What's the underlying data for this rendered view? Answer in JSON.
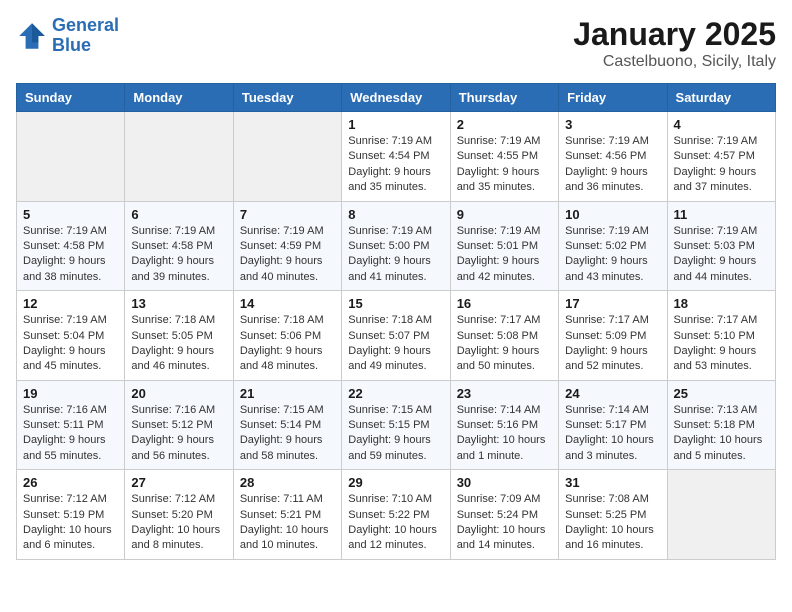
{
  "logo": {
    "line1": "General",
    "line2": "Blue"
  },
  "title": "January 2025",
  "subtitle": "Castelbuono, Sicily, Italy",
  "days_of_week": [
    "Sunday",
    "Monday",
    "Tuesday",
    "Wednesday",
    "Thursday",
    "Friday",
    "Saturday"
  ],
  "weeks": [
    [
      {
        "day": "",
        "info": ""
      },
      {
        "day": "",
        "info": ""
      },
      {
        "day": "",
        "info": ""
      },
      {
        "day": "1",
        "info": "Sunrise: 7:19 AM\nSunset: 4:54 PM\nDaylight: 9 hours and 35 minutes."
      },
      {
        "day": "2",
        "info": "Sunrise: 7:19 AM\nSunset: 4:55 PM\nDaylight: 9 hours and 35 minutes."
      },
      {
        "day": "3",
        "info": "Sunrise: 7:19 AM\nSunset: 4:56 PM\nDaylight: 9 hours and 36 minutes."
      },
      {
        "day": "4",
        "info": "Sunrise: 7:19 AM\nSunset: 4:57 PM\nDaylight: 9 hours and 37 minutes."
      }
    ],
    [
      {
        "day": "5",
        "info": "Sunrise: 7:19 AM\nSunset: 4:58 PM\nDaylight: 9 hours and 38 minutes."
      },
      {
        "day": "6",
        "info": "Sunrise: 7:19 AM\nSunset: 4:58 PM\nDaylight: 9 hours and 39 minutes."
      },
      {
        "day": "7",
        "info": "Sunrise: 7:19 AM\nSunset: 4:59 PM\nDaylight: 9 hours and 40 minutes."
      },
      {
        "day": "8",
        "info": "Sunrise: 7:19 AM\nSunset: 5:00 PM\nDaylight: 9 hours and 41 minutes."
      },
      {
        "day": "9",
        "info": "Sunrise: 7:19 AM\nSunset: 5:01 PM\nDaylight: 9 hours and 42 minutes."
      },
      {
        "day": "10",
        "info": "Sunrise: 7:19 AM\nSunset: 5:02 PM\nDaylight: 9 hours and 43 minutes."
      },
      {
        "day": "11",
        "info": "Sunrise: 7:19 AM\nSunset: 5:03 PM\nDaylight: 9 hours and 44 minutes."
      }
    ],
    [
      {
        "day": "12",
        "info": "Sunrise: 7:19 AM\nSunset: 5:04 PM\nDaylight: 9 hours and 45 minutes."
      },
      {
        "day": "13",
        "info": "Sunrise: 7:18 AM\nSunset: 5:05 PM\nDaylight: 9 hours and 46 minutes."
      },
      {
        "day": "14",
        "info": "Sunrise: 7:18 AM\nSunset: 5:06 PM\nDaylight: 9 hours and 48 minutes."
      },
      {
        "day": "15",
        "info": "Sunrise: 7:18 AM\nSunset: 5:07 PM\nDaylight: 9 hours and 49 minutes."
      },
      {
        "day": "16",
        "info": "Sunrise: 7:17 AM\nSunset: 5:08 PM\nDaylight: 9 hours and 50 minutes."
      },
      {
        "day": "17",
        "info": "Sunrise: 7:17 AM\nSunset: 5:09 PM\nDaylight: 9 hours and 52 minutes."
      },
      {
        "day": "18",
        "info": "Sunrise: 7:17 AM\nSunset: 5:10 PM\nDaylight: 9 hours and 53 minutes."
      }
    ],
    [
      {
        "day": "19",
        "info": "Sunrise: 7:16 AM\nSunset: 5:11 PM\nDaylight: 9 hours and 55 minutes."
      },
      {
        "day": "20",
        "info": "Sunrise: 7:16 AM\nSunset: 5:12 PM\nDaylight: 9 hours and 56 minutes."
      },
      {
        "day": "21",
        "info": "Sunrise: 7:15 AM\nSunset: 5:14 PM\nDaylight: 9 hours and 58 minutes."
      },
      {
        "day": "22",
        "info": "Sunrise: 7:15 AM\nSunset: 5:15 PM\nDaylight: 9 hours and 59 minutes."
      },
      {
        "day": "23",
        "info": "Sunrise: 7:14 AM\nSunset: 5:16 PM\nDaylight: 10 hours and 1 minute."
      },
      {
        "day": "24",
        "info": "Sunrise: 7:14 AM\nSunset: 5:17 PM\nDaylight: 10 hours and 3 minutes."
      },
      {
        "day": "25",
        "info": "Sunrise: 7:13 AM\nSunset: 5:18 PM\nDaylight: 10 hours and 5 minutes."
      }
    ],
    [
      {
        "day": "26",
        "info": "Sunrise: 7:12 AM\nSunset: 5:19 PM\nDaylight: 10 hours and 6 minutes."
      },
      {
        "day": "27",
        "info": "Sunrise: 7:12 AM\nSunset: 5:20 PM\nDaylight: 10 hours and 8 minutes."
      },
      {
        "day": "28",
        "info": "Sunrise: 7:11 AM\nSunset: 5:21 PM\nDaylight: 10 hours and 10 minutes."
      },
      {
        "day": "29",
        "info": "Sunrise: 7:10 AM\nSunset: 5:22 PM\nDaylight: 10 hours and 12 minutes."
      },
      {
        "day": "30",
        "info": "Sunrise: 7:09 AM\nSunset: 5:24 PM\nDaylight: 10 hours and 14 minutes."
      },
      {
        "day": "31",
        "info": "Sunrise: 7:08 AM\nSunset: 5:25 PM\nDaylight: 10 hours and 16 minutes."
      },
      {
        "day": "",
        "info": ""
      }
    ]
  ]
}
